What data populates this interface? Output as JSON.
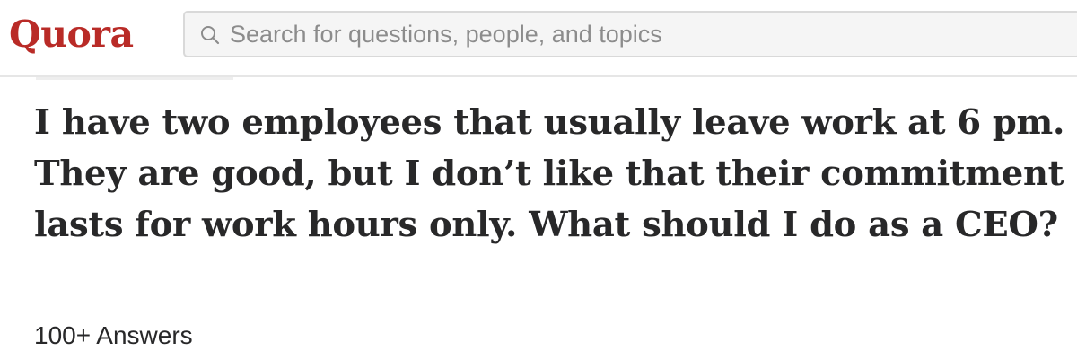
{
  "header": {
    "logo_text": "Quora",
    "brand_color": "#b92b27",
    "search": {
      "icon": "search-icon",
      "placeholder": "Search for questions, people, and topics"
    }
  },
  "question": {
    "title": "I have two employees that usually leave work at 6 pm. They are good, but I don’t like that their commitment lasts for work hours only. What should I do as a CEO?",
    "answer_count": "100+ Answers"
  }
}
